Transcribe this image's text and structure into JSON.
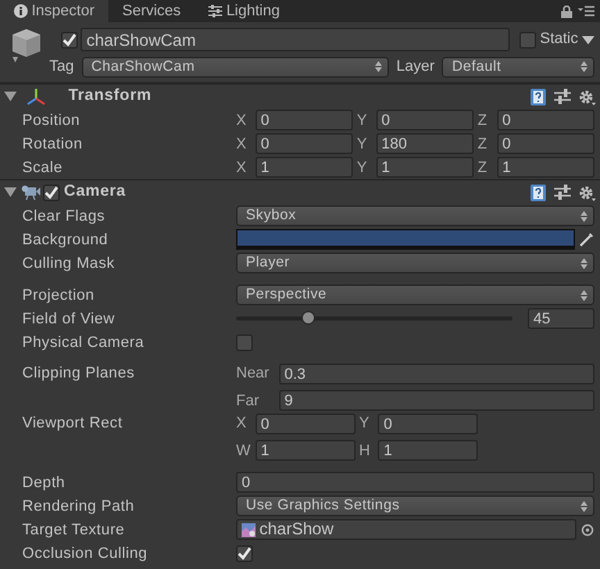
{
  "tabs": [
    {
      "label": "Inspector",
      "selected": true
    },
    {
      "label": "Services",
      "selected": false
    },
    {
      "label": "Lighting",
      "selected": false
    }
  ],
  "object": {
    "active": true,
    "name": "charShowCam",
    "static": false,
    "static_label": "Static",
    "tag_label": "Tag",
    "tag": "CharShowCam",
    "layer_label": "Layer",
    "layer": "Default"
  },
  "components": [
    {
      "kind": "transform",
      "title": "Transform",
      "expanded": true,
      "rows": [
        {
          "kind": "vector",
          "label": "Position",
          "fields": [
            {
              "axis": "X",
              "value": "0"
            },
            {
              "axis": "Y",
              "value": "0"
            },
            {
              "axis": "Z",
              "value": "0"
            }
          ]
        },
        {
          "kind": "vector",
          "label": "Rotation",
          "fields": [
            {
              "axis": "X",
              "value": "0"
            },
            {
              "axis": "Y",
              "value": "180"
            },
            {
              "axis": "Z",
              "value": "0"
            }
          ]
        },
        {
          "kind": "vector",
          "label": "Scale",
          "fields": [
            {
              "axis": "X",
              "value": "1"
            },
            {
              "axis": "Y",
              "value": "1"
            },
            {
              "axis": "Z",
              "value": "1"
            }
          ]
        }
      ]
    },
    {
      "kind": "camera",
      "title": "Camera",
      "expanded": true,
      "enabled": true,
      "rows": [
        {
          "kind": "dropdown",
          "label": "Clear Flags",
          "value": "Skybox"
        },
        {
          "kind": "color",
          "label": "Background",
          "color": "#2e4b78"
        },
        {
          "kind": "dropdown",
          "label": "Culling Mask",
          "value": "Player"
        },
        {
          "kind": "dropdown",
          "label": "Projection",
          "value": "Perspective",
          "gap_before": true
        },
        {
          "kind": "slider",
          "label": "Field of View",
          "level": 0.26,
          "value": "45"
        },
        {
          "kind": "checkbox",
          "label": "Physical Camera",
          "checked": false
        },
        {
          "kind": "stacked",
          "label": "Clipping Planes",
          "gap_before": true,
          "fields": [
            {
              "axis": "Near",
              "value": "0.3"
            },
            {
              "axis": "Far",
              "value": "9"
            }
          ]
        },
        {
          "kind": "grid",
          "label": "Viewport Rect",
          "fields": [
            [
              {
                "axis": "X",
                "value": "0"
              },
              {
                "axis": "Y",
                "value": "0"
              }
            ],
            [
              {
                "axis": "W",
                "value": "1"
              },
              {
                "axis": "H",
                "value": "1"
              }
            ]
          ]
        },
        {
          "kind": "text",
          "label": "Depth",
          "value": "0",
          "gap_before": true
        },
        {
          "kind": "dropdown",
          "label": "Rendering Path",
          "value": "Use Graphics Settings"
        },
        {
          "kind": "object",
          "label": "Target Texture",
          "value": "charShow"
        },
        {
          "kind": "checkbox",
          "label": "Occlusion Culling",
          "checked": true
        }
      ]
    }
  ]
}
